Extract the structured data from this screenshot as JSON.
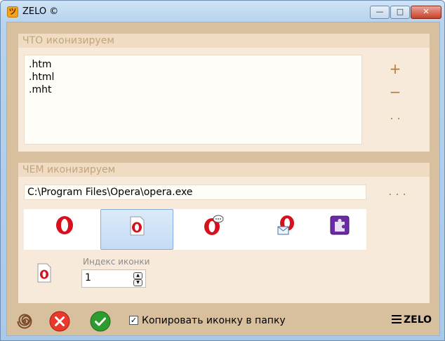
{
  "window": {
    "title": "ZELO ©",
    "min_label": "—",
    "max_label": "□",
    "close_label": "✕"
  },
  "what_group": {
    "title": "ЧТО иконизируем",
    "extensions": [
      ".htm",
      ".html",
      ".mht"
    ],
    "add_label": "+",
    "remove_label": "−",
    "browse_label": ". ."
  },
  "with_group": {
    "title": "ЧЕМ иконизируем",
    "path": "C:\\Program Files\\Opera\\opera.exe",
    "browse_label": ". . .",
    "icons": [
      {
        "name": "opera-logo-icon",
        "selected": false
      },
      {
        "name": "opera-document-icon",
        "selected": true
      },
      {
        "name": "opera-chat-icon",
        "selected": false
      },
      {
        "name": "opera-mail-icon",
        "selected": false
      },
      {
        "name": "puzzle-extension-icon",
        "selected": false
      }
    ],
    "index_label": "Индекс иконки",
    "index_value": "1",
    "spin_up": "▲",
    "spin_down": "▼"
  },
  "bottom": {
    "copy_checked": true,
    "check_mark": "✓",
    "copy_label": "Копировать иконку в папку",
    "brand_label": "ZELO"
  },
  "colors": {
    "accent": "#b87b3c",
    "cancel": "#e8392b",
    "ok": "#2e9b2e",
    "spiral": "#7a4a2a"
  }
}
